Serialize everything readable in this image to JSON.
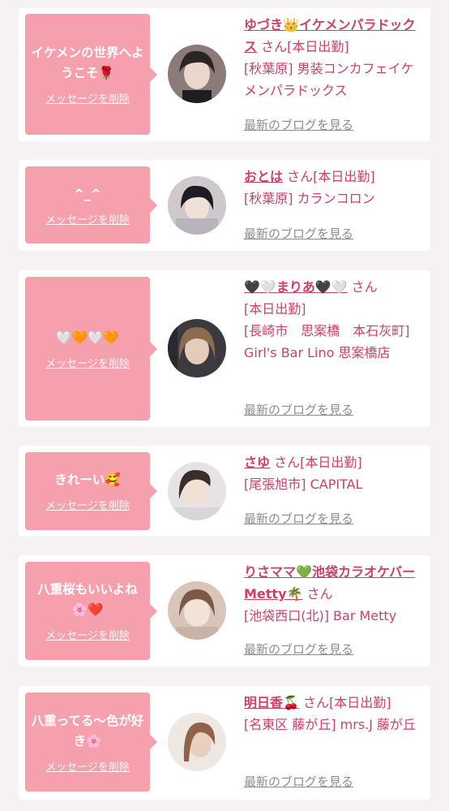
{
  "delete_label": "メッセージを削除",
  "blog_label": "最新のブログを見る",
  "san": "さん",
  "cards": [
    {
      "message": "イケメンの世界へようこそ🌹",
      "name_a": "ゆづき",
      "name_emoji": "👑",
      "name_b": "イケメンパラドックス",
      "status": "[本日出勤]",
      "shop": "[秋葉原] 男装コンカフェイケメンパラドックス"
    },
    {
      "message": "^_^",
      "name": "おとは",
      "status": "[本日出勤]",
      "shop": "[秋葉原] カランコロン"
    },
    {
      "message": "🤍🧡🤍🧡",
      "name_prefix_emoji": "🖤🤍",
      "name": "まりあ",
      "name_suffix_emoji": "🖤🤍",
      "status": "[本日出勤]",
      "shop": "[長崎市　思案橋　本石灰町] Girl's Bar Lino 思案橋店"
    },
    {
      "message": "きれーい🥰",
      "name": "さゆ",
      "status": "[本日出勤]",
      "shop": "[尾張旭市] CAPITAL"
    },
    {
      "message": "八重桜もいいよね🌸❤️",
      "name_a": "りさママ",
      "name_emoji": "💚",
      "name_b": "池袋カラオケバーMetty",
      "name_emoji2": "🌴",
      "status": "",
      "shop": "[池袋西口(北)] Bar Metty"
    },
    {
      "message": "八重ってる〜色が好き🌸",
      "name": "明日香",
      "name_emoji": "🍒",
      "status": "[本日出勤]",
      "shop": "[名東区 藤が丘] mrs.J 藤が丘"
    }
  ],
  "colors": {
    "background": "#f6f2f3",
    "bubble": "#f7a0ad",
    "accent": "#d23e66",
    "link_gray": "#8d8d8d"
  },
  "icons": [
    "heart-icon",
    "crown-icon",
    "rose-icon",
    "sakura-icon",
    "cherry-icon",
    "palm-icon"
  ]
}
